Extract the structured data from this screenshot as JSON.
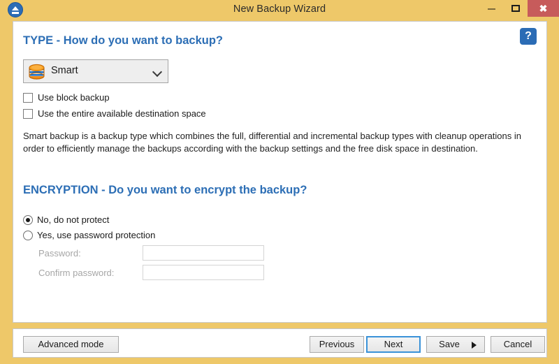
{
  "window": {
    "title": "New Backup Wizard",
    "app_icon": "eject-disc-icon",
    "controls": {
      "minimize": "minimize-icon",
      "maximize": "maximize-icon",
      "close": "✖"
    },
    "titlebar_color": "#eec869",
    "accent_color": "#2c6eb5"
  },
  "help": {
    "icon": "question-mark-icon",
    "glyph": "?"
  },
  "type_section": {
    "heading": "TYPE - How do you want to backup?",
    "combo": {
      "icon": "database-icon",
      "selected": "Smart",
      "chevron": "chevron-down-icon",
      "options": [
        "Smart"
      ]
    },
    "checkboxes": [
      {
        "label": "Use block backup",
        "checked": false
      },
      {
        "label": "Use the entire available destination space",
        "checked": false
      }
    ],
    "description": "Smart backup is a backup type which combines the full, differential and incremental backup types with cleanup operations in order to efficiently manage the backups according with the backup settings and the free disk space in destination."
  },
  "encryption_section": {
    "heading": "ENCRYPTION - Do you want to encrypt the backup?",
    "radios": [
      {
        "label": "No, do not protect",
        "selected": true
      },
      {
        "label": "Yes, use password protection",
        "selected": false
      }
    ],
    "fields": [
      {
        "label": "Password:",
        "value": "",
        "placeholder": "",
        "disabled": true
      },
      {
        "label": "Confirm password:",
        "value": "",
        "placeholder": "",
        "disabled": true
      }
    ]
  },
  "footer": {
    "advanced_mode": "Advanced mode",
    "previous": "Previous",
    "next": "Next",
    "save": "Save",
    "save_arrow": "caret-right-icon",
    "cancel": "Cancel"
  }
}
